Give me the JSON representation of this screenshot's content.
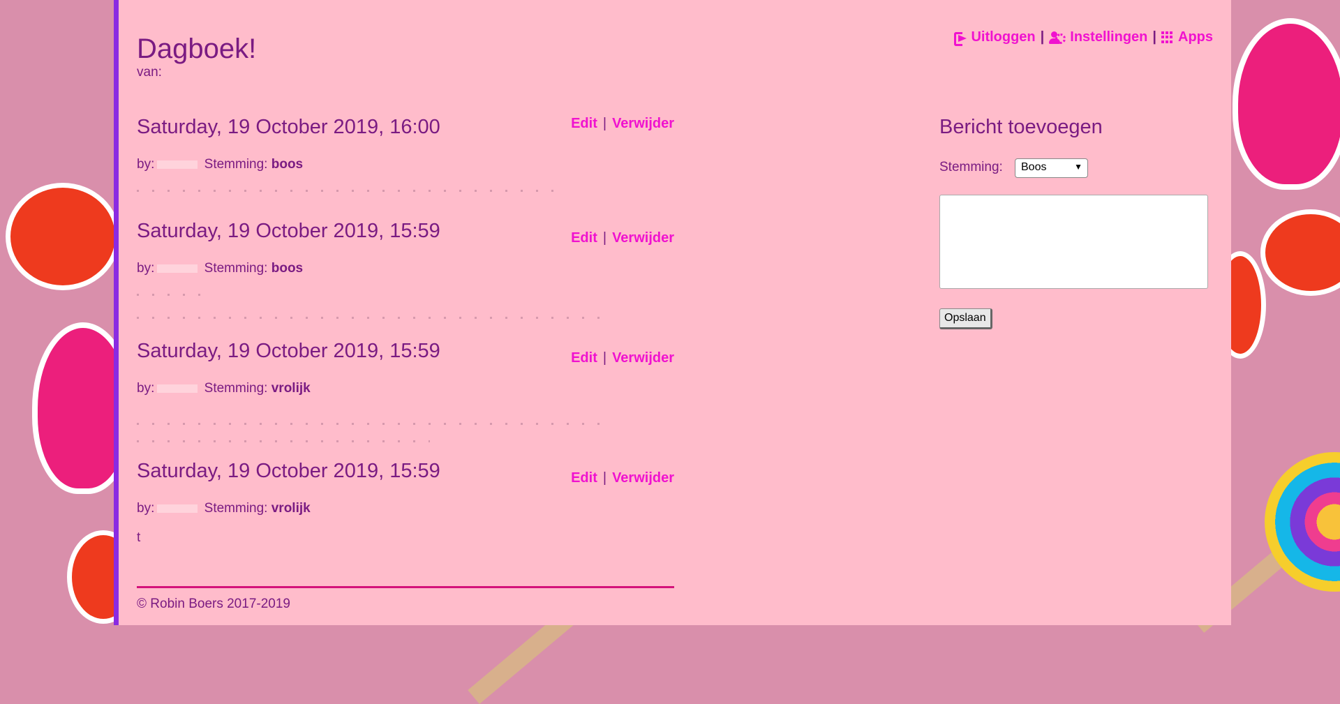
{
  "header": {
    "title": "Dagboek!",
    "subtitle": "van:"
  },
  "nav": {
    "logout": "Uitloggen",
    "settings": "Instellingen",
    "apps": "Apps",
    "separator": "|"
  },
  "entries": [
    {
      "date": "Saturday, 19 October 2019, 16:00",
      "by_label": "by:",
      "mood_label": "Stemming:",
      "mood": "boos",
      "edit": "Edit",
      "delete": "Verwijder"
    },
    {
      "date": "Saturday, 19 October 2019, 15:59",
      "by_label": "by:",
      "mood_label": "Stemming:",
      "mood": "boos",
      "edit": "Edit",
      "delete": "Verwijder"
    },
    {
      "date": "Saturday, 19 October 2019, 15:59",
      "by_label": "by:",
      "mood_label": "Stemming:",
      "mood": "vrolijk",
      "edit": "Edit",
      "delete": "Verwijder"
    },
    {
      "date": "Saturday, 19 October 2019, 15:59",
      "by_label": "by:",
      "mood_label": "Stemming:",
      "mood": "vrolijk",
      "edit": "Edit",
      "delete": "Verwijder",
      "body": "t"
    }
  ],
  "action_separator": "|",
  "form": {
    "title": "Bericht toevoegen",
    "mood_label": "Stemming:",
    "mood_selected": "Boos",
    "message_value": "",
    "save": "Opslaan"
  },
  "footer": {
    "copyright": "© Robin Boers 2017-2019"
  },
  "colors": {
    "panel": "#ffbccb",
    "text": "#7a1b82",
    "link": "#f012cf",
    "accent_border": "#8a2be2",
    "footer_rule": "#d4127a",
    "background": "#d98fab"
  }
}
